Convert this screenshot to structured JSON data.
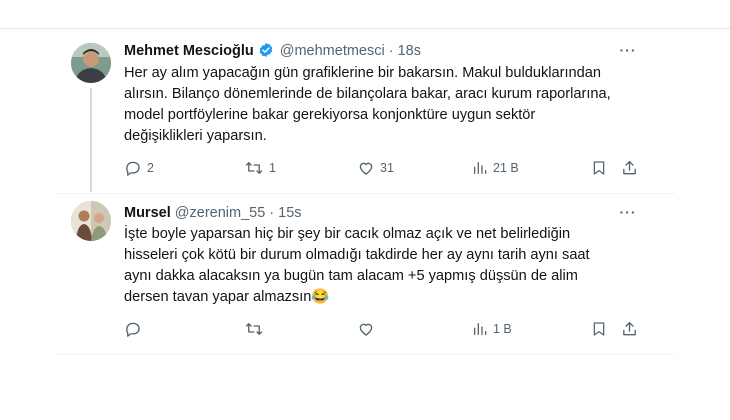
{
  "tweets": [
    {
      "author_name": "Mehmet Mescioğlu",
      "author_handle": "@mehmetmesci",
      "time": "· 18s",
      "verified": true,
      "text": "Her ay alım yapacağın gün grafiklerine bir bakarsın. Makul bulduklarından\nalırsın. Bilanço dönemlerinde de bilançolara bakar, aracı kurum raporlarına,\nmodel portföylerine bakar gerekiyorsa konjonktüre uygun sektör\ndeğişiklikleri yaparsın.",
      "actions": {
        "replies": "2",
        "retweets": "1",
        "likes": "31",
        "views": "21 B"
      }
    },
    {
      "author_name": "Mursel",
      "author_handle": "@zerenim_55",
      "time": "· 15s",
      "verified": false,
      "text": "İşte boyle yaparsan hiç bir şey bir cacık olmaz açık ve net belirlediğin\nhisseleri çok kötü bir durum olmadığı takdirde her ay aynı tarih aynı saat\naynı dakka alacaksın ya bugün tam alacam +5 yapmış düşsün de alim\ndersen tavan yapar almazsın😂",
      "actions": {
        "replies": "",
        "retweets": "",
        "likes": "",
        "views": "1 B"
      }
    }
  ],
  "icons": {
    "verified_color": "#1d9bf0",
    "reply": "reply-icon",
    "retweet": "retweet-icon",
    "like": "heart-icon",
    "views": "views-icon",
    "bookmark": "bookmark-icon",
    "share": "share-icon",
    "more": "more-icon"
  }
}
